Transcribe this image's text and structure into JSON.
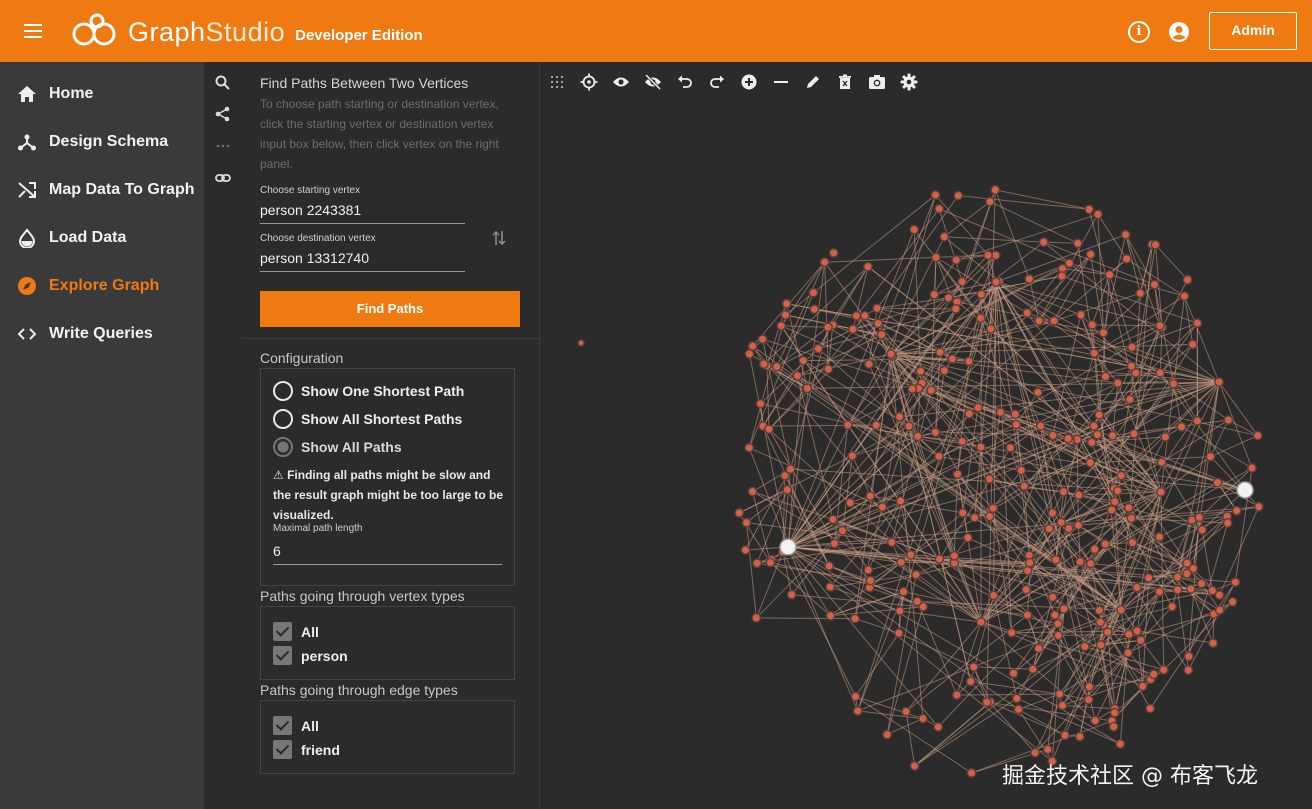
{
  "app": {
    "logo_a": "Graph",
    "logo_b": "Studio",
    "edition": "Developer Edition",
    "info_label": "i",
    "admin_label": "Admin"
  },
  "nav": {
    "items": [
      {
        "label": "Home",
        "icon": "home-icon"
      },
      {
        "label": "Design Schema",
        "icon": "schema-icon"
      },
      {
        "label": "Map Data To Graph",
        "icon": "shuffle-icon"
      },
      {
        "label": "Load Data",
        "icon": "drop-icon"
      },
      {
        "label": "Explore Graph",
        "icon": "compass-icon",
        "active": true
      },
      {
        "label": "Write Queries",
        "icon": "code-icon"
      }
    ]
  },
  "panel": {
    "title": "Find Paths Between Two Vertices",
    "description": "To choose path starting or destination vertex, click the starting vertex or destination vertex input box below, then click vertex on the right panel.",
    "start_label": "Choose starting vertex",
    "start_value": "person 2243381",
    "dest_label": "Choose destination vertex",
    "dest_value": "person 13312740",
    "find_button": "Find Paths",
    "config_title": "Configuration",
    "options": [
      "Show One Shortest Path",
      "Show All Shortest Paths",
      "Show All Paths"
    ],
    "selected_option": 2,
    "warning": "⚠ Finding all paths might be slow and the result graph might be too large to be visualized.",
    "maxlen_label": "Maximal path length",
    "maxlen_value": "6",
    "vertex_types_title": "Paths going through vertex types",
    "vertex_types": [
      "All",
      "person"
    ],
    "edge_types_title": "Paths going through edge types",
    "edge_types": [
      "All",
      "friend"
    ]
  },
  "colors": {
    "accent": "#f07a12",
    "node": "#d4604a",
    "edge": "#c99a84"
  },
  "watermark": "掘金技术社区 @ 布客飞龙"
}
